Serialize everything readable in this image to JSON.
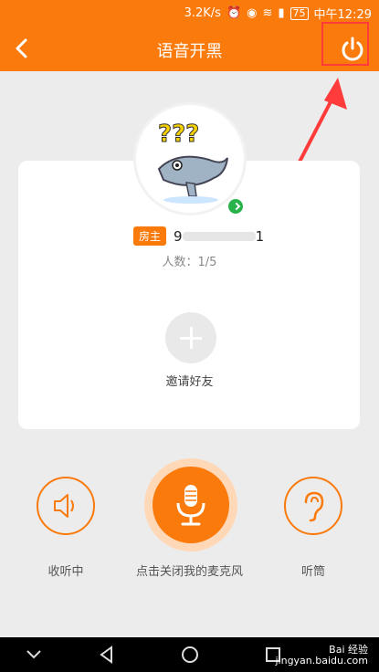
{
  "status": {
    "net_speed": "3.2K/s",
    "battery": "75",
    "time": "中午12:29"
  },
  "appbar": {
    "title": "语音开黑"
  },
  "room": {
    "host_badge": "房主",
    "host_name_start": "9",
    "host_name_end": "1",
    "count_text": "人数：1/5",
    "invite_label": "邀请好友"
  },
  "controls": {
    "listen_label": "收听中",
    "mic_label": "点击关闭我的麦克风",
    "earpiece_label": "听筒"
  },
  "watermark": {
    "line1": "Bai 经验",
    "line2": "jingyan.baidu.com"
  },
  "colors": {
    "accent": "#fa7a0c",
    "annotation": "#ff3b3b",
    "online": "#27b24a"
  },
  "icons": [
    "back-icon",
    "power-icon",
    "plus-icon",
    "speaker-icon",
    "mic-icon",
    "ear-icon",
    "nav-back-icon",
    "nav-home-icon",
    "nav-recents-icon"
  ]
}
